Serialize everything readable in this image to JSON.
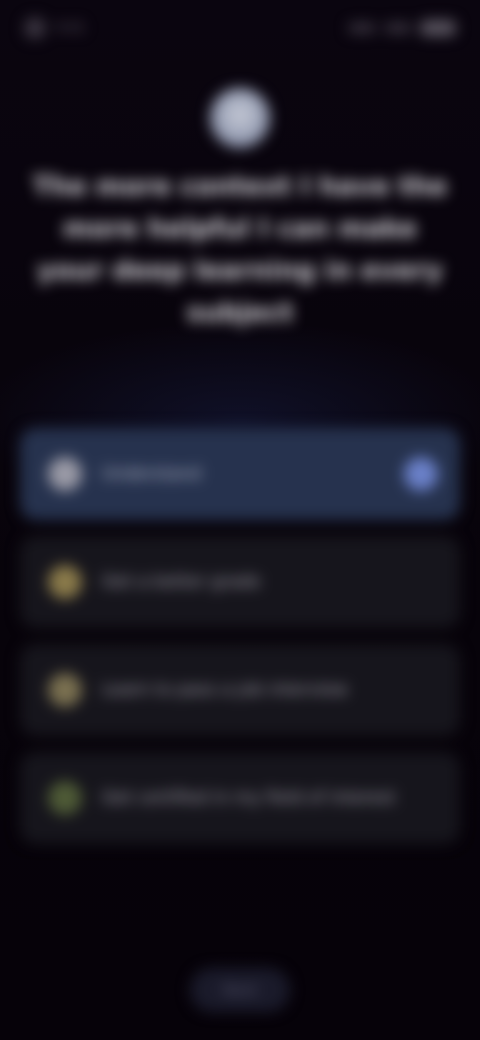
{
  "status_bar": {
    "time": "9:41"
  },
  "headline": "The more context I have the more helpful I can make your deep learning in every subject",
  "options": [
    {
      "label": "Understand",
      "icon": "circle-icon",
      "color": "#9a9aa6",
      "selected": true
    },
    {
      "label": "Get a better grade",
      "icon": "star-icon",
      "color": "#8a7a4a",
      "selected": false
    },
    {
      "label": "Learn to pass a job interview",
      "icon": "bulb-icon",
      "color": "#7a7050",
      "selected": false
    },
    {
      "label": "Get certified in my field of interest",
      "icon": "leaf-icon",
      "color": "#4e5a36",
      "selected": false
    }
  ],
  "continue_label": "Next",
  "colors": {
    "background": "#07030a",
    "selected_option": "#26324e",
    "option": "#16151c",
    "check": "#6a80c8"
  }
}
